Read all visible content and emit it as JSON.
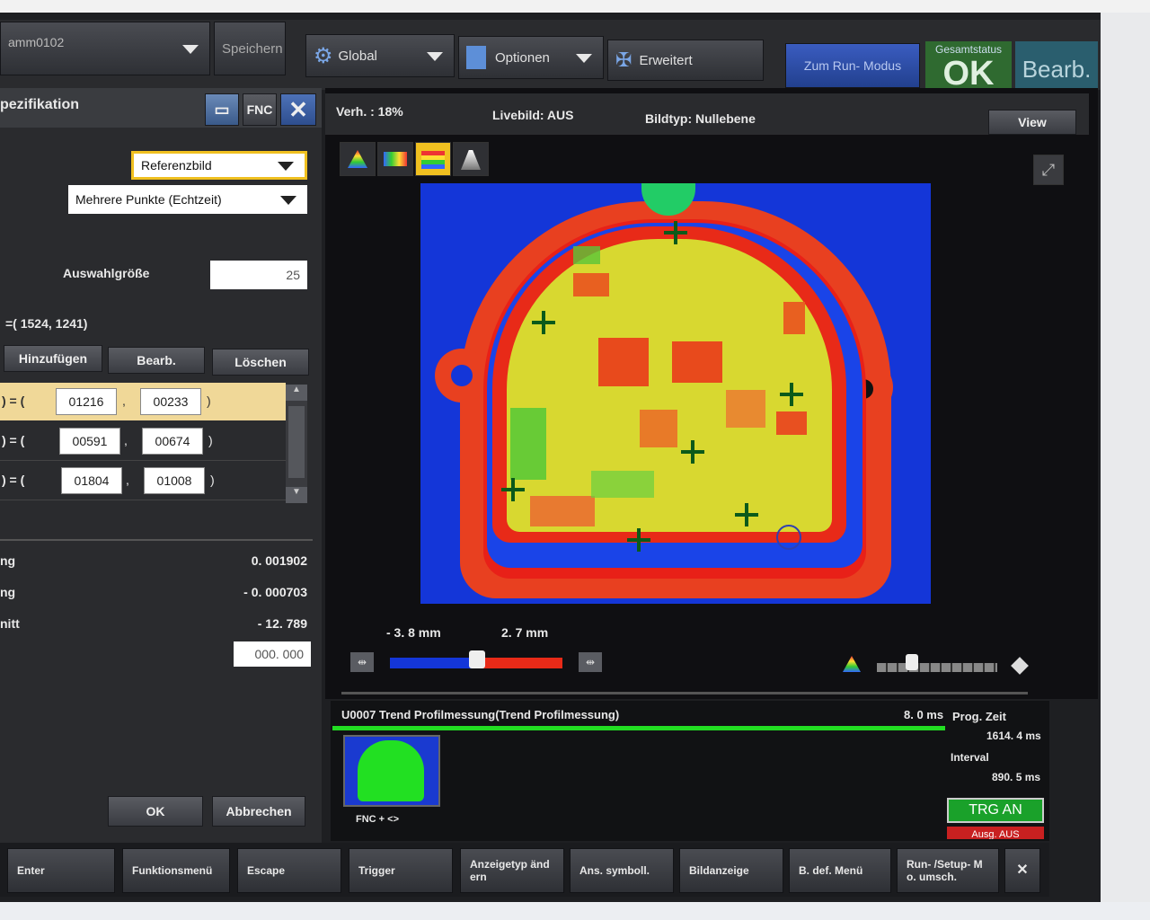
{
  "toolbar": {
    "program_name": "amm0102",
    "save_label": "Speichern",
    "global_label": "Global",
    "options_label": "Optionen",
    "extended_label": "Erweitert",
    "run_mode_label": "Zum Run- Modus",
    "status_caption": "Gesamtstatus",
    "status_value": "OK",
    "edit_label": "Bearb."
  },
  "left_panel": {
    "title": "pezifikation",
    "fnc_label": "FNC",
    "reference_select": "Referenzbild",
    "points_select": "Mehrere Punkte (Echtzeit)",
    "selection_size_label": "Auswahlgröße",
    "selection_size_value": "25",
    "coord_text": "=( 1524,   1241)",
    "add_label": "Hinzufügen",
    "edit_label": "Bearb.",
    "delete_label": "Löschen",
    "points": [
      {
        "prefix": ") = (",
        "x": "01216",
        "y": "00233",
        "suffix": ")"
      },
      {
        "prefix": ") = (",
        "x": "00591",
        "y": "00674",
        "suffix": ")"
      },
      {
        "prefix": ") = (",
        "x": "01804",
        "y": "01008",
        "suffix": ")"
      }
    ],
    "results": [
      {
        "label": "ng",
        "value": "0. 001902"
      },
      {
        "label": "ng",
        "value": "- 0. 000703"
      },
      {
        "label": "nitt",
        "value": "- 12. 789"
      }
    ],
    "offset_value": "000. 000",
    "ok_label": "OK",
    "cancel_label": "Abbrechen"
  },
  "image_view": {
    "ratio": "Verh. :  18%",
    "live_label": "Livebild:  AUS",
    "image_type_label": "Bildtyp:  Nullebene",
    "view_label": "View",
    "range_min": "- 3. 8  mm",
    "range_max": "2. 7  mm"
  },
  "trend": {
    "title": "U0007  Trend  Profilmessung(Trend  Profilmessung)",
    "time_ms": "8. 0 ms",
    "prog_label": "Prog.  Zeit",
    "prog_value": "1614. 4 ms",
    "interval_label": "Interval",
    "interval_value": "890. 5 ms",
    "fnc_text": "FNC  +  <>",
    "trg_on_label": "TRG AN",
    "trg_off_label": "Ausg. AUS"
  },
  "bottom_bar": {
    "buttons": [
      "Enter",
      "Funktionsmenü",
      "Escape",
      "Trigger",
      "Anzeigetyp  änd ern",
      "Ans. symboll.",
      "Bildanzeige",
      "B. def.  Menü",
      "Run- /Setup- M o.  umsch."
    ],
    "close_label": "✕"
  },
  "colors": {
    "accent_blue": "#2a4aa8",
    "ok_green": "#3a8a3a",
    "trg_green": "#1aa12a",
    "highlight_row": "#f0d898"
  }
}
